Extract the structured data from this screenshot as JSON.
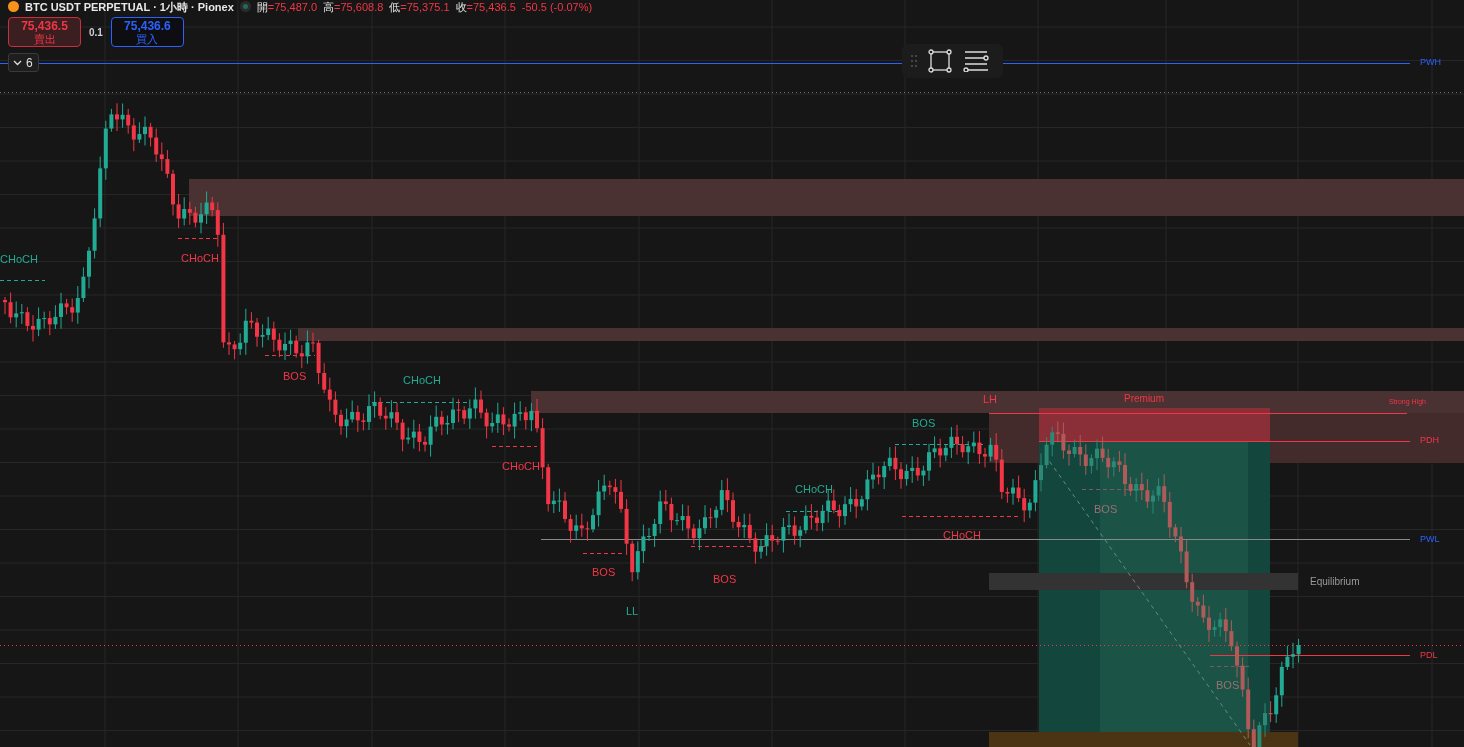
{
  "header": {
    "symbol": "BTC USDT PERPETUAL · 1小時 · Pionex",
    "ohlc": [
      {
        "label": "開",
        "value": "=75,487.0"
      },
      {
        "label": "高",
        "value": "=75,608.8"
      },
      {
        "label": "低",
        "value": "=75,375.1"
      },
      {
        "label": "收",
        "value": "=75,436.5"
      }
    ],
    "change": "-50.5 (-0.07%)"
  },
  "trade": {
    "sell": {
      "price": "75,436.5",
      "label": "賣出"
    },
    "quantity": "0.1",
    "buy": {
      "price": "75,436.6",
      "label": "買入"
    }
  },
  "indicators_toggle": {
    "count": "6"
  },
  "chart": {
    "structure_labels": [
      {
        "text": "CHoCH",
        "kind": "bullish"
      },
      {
        "text": "CHoCH",
        "kind": "bearish"
      },
      {
        "text": "BOS",
        "kind": "bearish"
      },
      {
        "text": "CHoCH",
        "kind": "bullish"
      },
      {
        "text": "CHoCH",
        "kind": "bearish"
      },
      {
        "text": "BOS",
        "kind": "bullish"
      },
      {
        "text": "CHoCH",
        "kind": "bullish"
      },
      {
        "text": "BOS",
        "kind": "bearish"
      },
      {
        "text": "BOS",
        "kind": "bearish"
      },
      {
        "text": "LL",
        "kind": "bullish"
      },
      {
        "text": "CHoCH",
        "kind": "bearish"
      },
      {
        "text": "BOS",
        "kind": "faded"
      },
      {
        "text": "BOS",
        "kind": "faded"
      },
      {
        "text": "LH",
        "kind": "bearish"
      }
    ],
    "zone_labels": [
      {
        "text": "Premium",
        "kind": "premium"
      },
      {
        "text": "Strong High",
        "kind": "premium"
      },
      {
        "text": "Equilibrium",
        "kind": "equilibrium"
      }
    ],
    "level_labels": [
      {
        "text": "PWH",
        "kind": "weekly"
      },
      {
        "text": "PDH",
        "kind": "daily"
      },
      {
        "text": "PWL",
        "kind": "weekly"
      },
      {
        "text": "PDL",
        "kind": "daily"
      }
    ]
  }
}
